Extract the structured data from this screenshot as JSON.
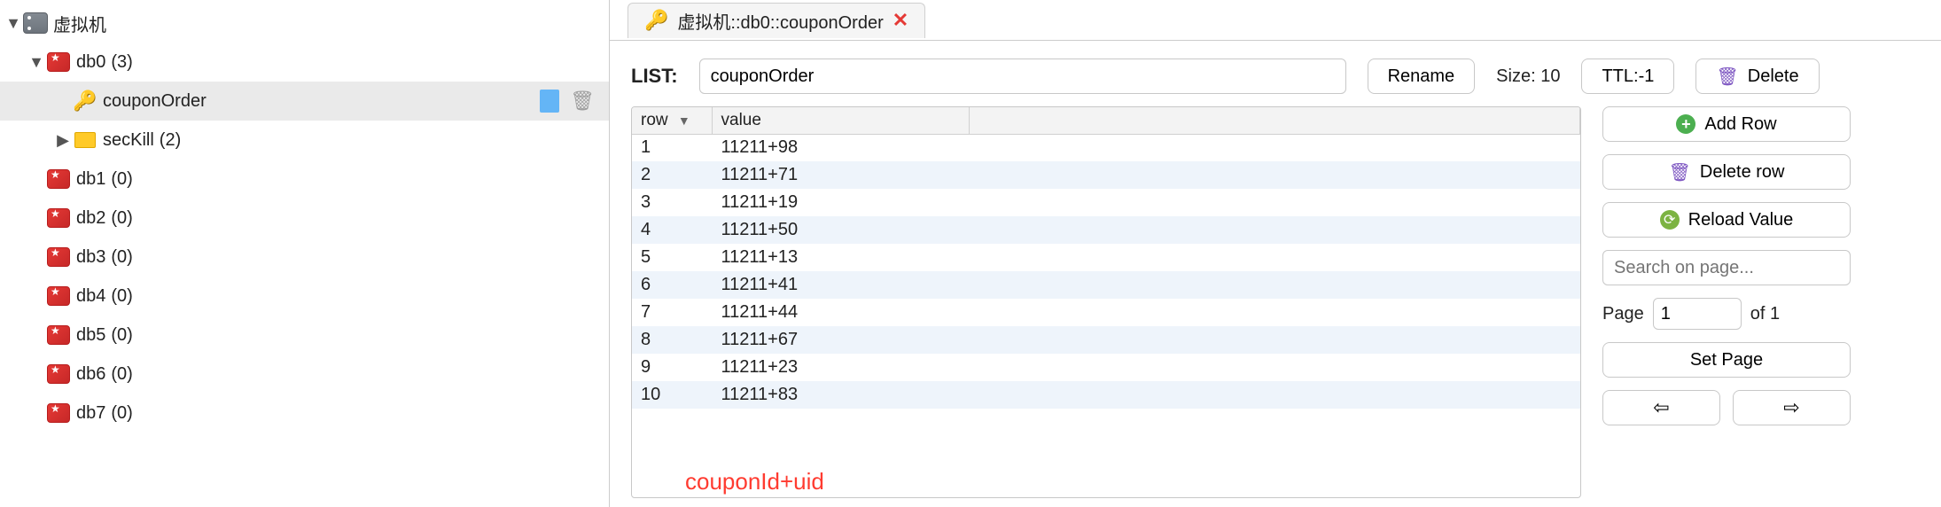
{
  "tree": {
    "root": {
      "label": "虚拟机"
    },
    "db0": {
      "label": "db0",
      "count": "(3)"
    },
    "couponOrder": {
      "label": "couponOrder"
    },
    "secKill": {
      "label": "secKill",
      "count": "(2)"
    },
    "db1": {
      "label": "db1",
      "count": "(0)"
    },
    "db2": {
      "label": "db2",
      "count": "(0)"
    },
    "db3": {
      "label": "db3",
      "count": "(0)"
    },
    "db4": {
      "label": "db4",
      "count": "(0)"
    },
    "db5": {
      "label": "db5",
      "count": "(0)"
    },
    "db6": {
      "label": "db6",
      "count": "(0)"
    },
    "db7": {
      "label": "db7",
      "count": "(0)"
    }
  },
  "tab": {
    "title": "虚拟机::db0::couponOrder"
  },
  "toolbar": {
    "type_label": "LIST:",
    "key_value": "couponOrder",
    "rename_label": "Rename",
    "size_label": "Size:",
    "size_value": "10",
    "ttl_label": "TTL:-1",
    "delete_label": "Delete"
  },
  "table": {
    "col_row": "row",
    "col_value": "value",
    "rows": [
      {
        "n": "1",
        "v": "11211+98"
      },
      {
        "n": "2",
        "v": "11211+71"
      },
      {
        "n": "3",
        "v": "11211+19"
      },
      {
        "n": "4",
        "v": "11211+50"
      },
      {
        "n": "5",
        "v": "11211+13"
      },
      {
        "n": "6",
        "v": "11211+41"
      },
      {
        "n": "7",
        "v": "11211+44"
      },
      {
        "n": "8",
        "v": "11211+67"
      },
      {
        "n": "9",
        "v": "11211+23"
      },
      {
        "n": "10",
        "v": "11211+83"
      }
    ],
    "annotation": "couponId+uid"
  },
  "actions": {
    "add_row": "Add Row",
    "delete_row": "Delete row",
    "reload": "Reload Value",
    "search_placeholder": "Search on page...",
    "page_label": "Page",
    "page_value": "1",
    "page_of": "of 1",
    "set_page": "Set Page",
    "prev": "⇦",
    "next": "⇨"
  }
}
